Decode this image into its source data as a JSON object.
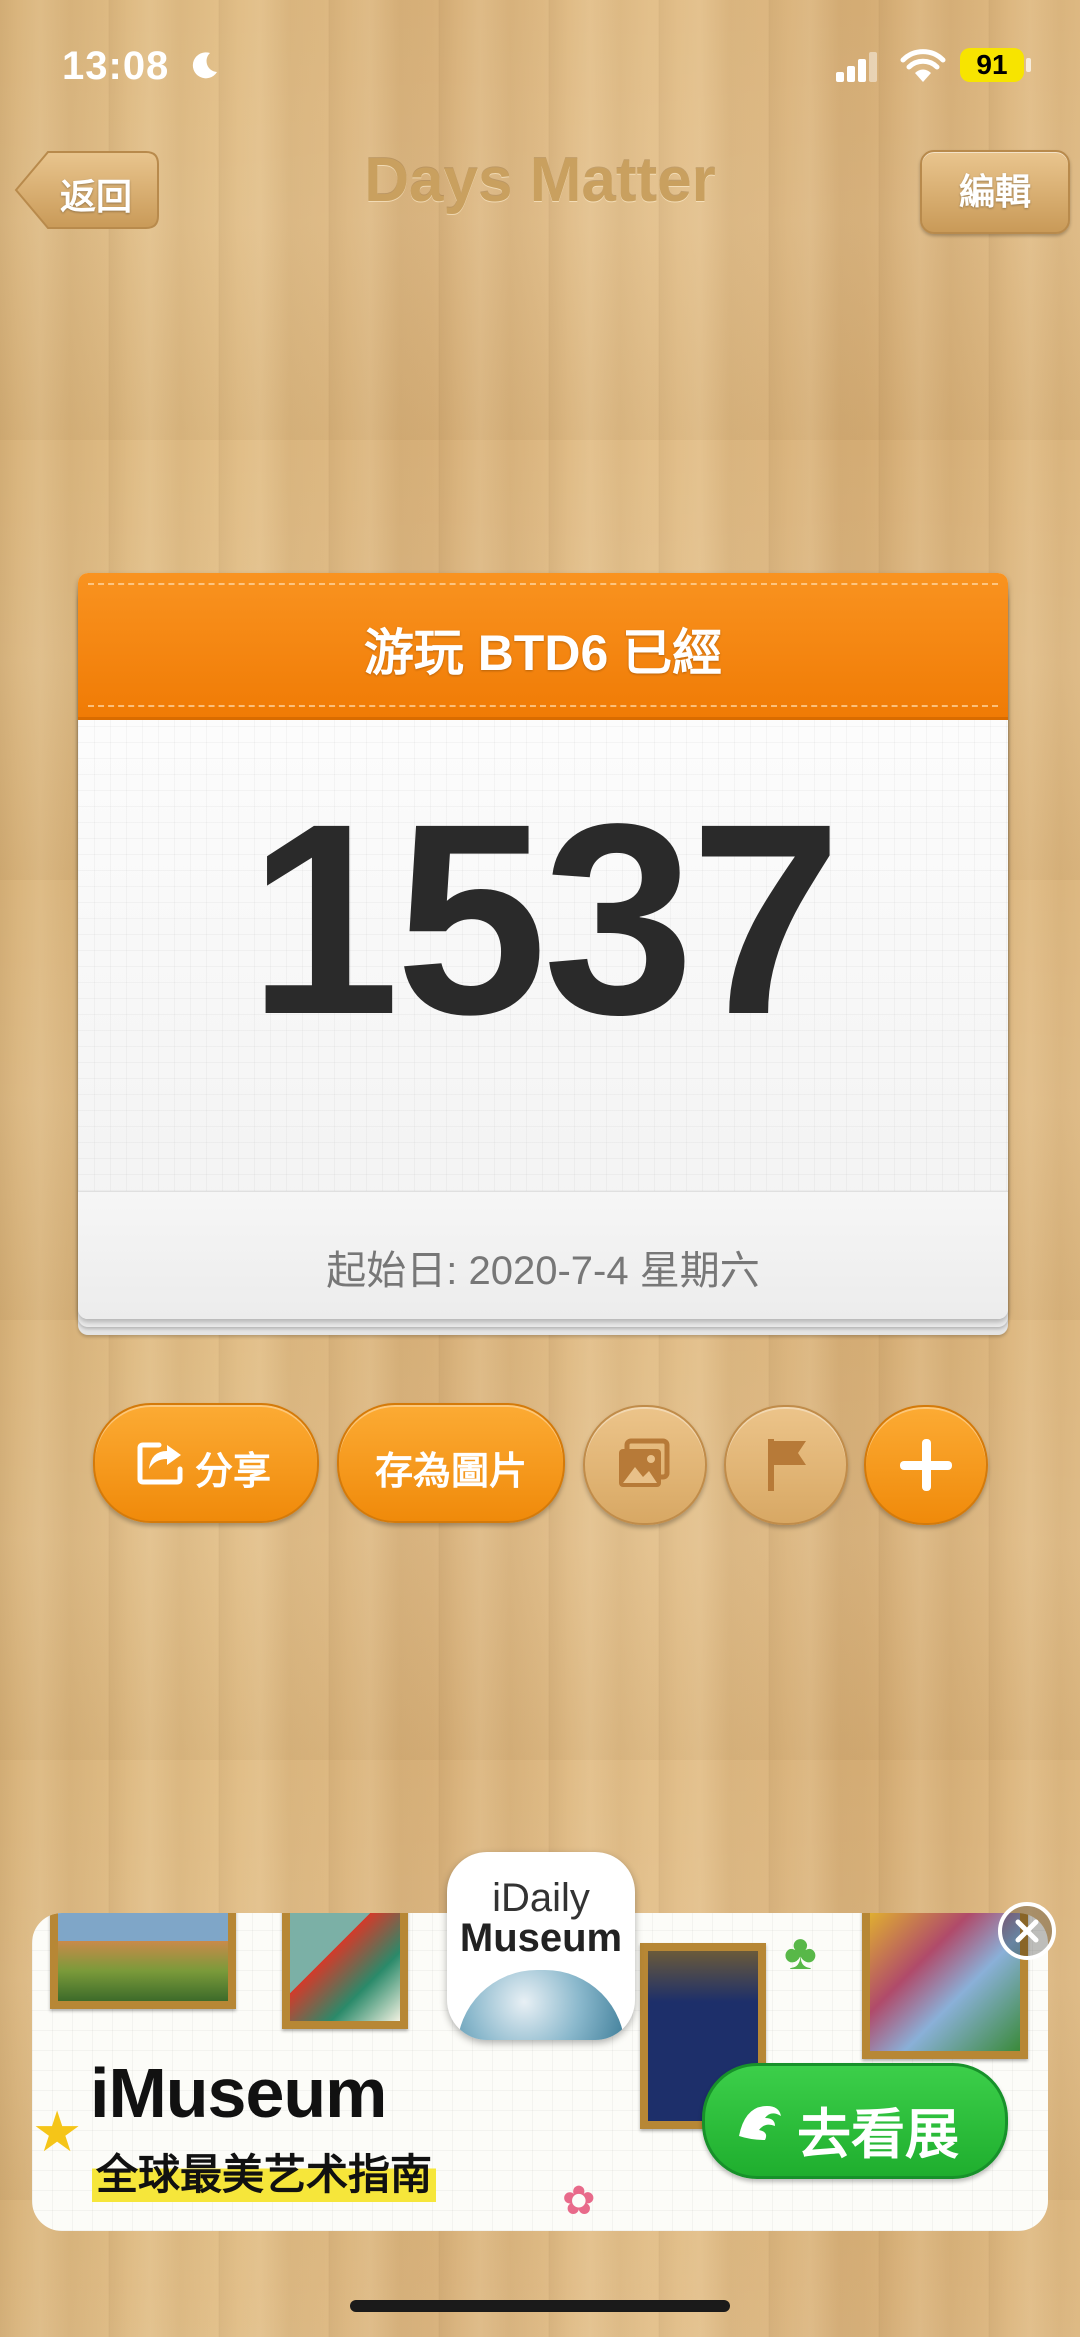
{
  "status_bar": {
    "time": "13:08",
    "battery": "91"
  },
  "nav": {
    "back_label": "返回",
    "title": "Days Matter",
    "edit_label": "編輯"
  },
  "card": {
    "title": "游玩 BTD6 已經",
    "count": "1537",
    "start_date": "起始日: 2020-7-4 星期六"
  },
  "actions": {
    "share_label": "分享",
    "save_image_label": "存為圖片"
  },
  "ad": {
    "app_name_line1": "iDaily",
    "app_name_line2": "Museum",
    "title": "iMuseum",
    "subtitle": "全球最美艺术指南",
    "cta_label": "去看展"
  },
  "colors": {
    "accent_orange": "#f08a0a",
    "ad_cta_green": "#1fae2e",
    "wood": "#ddb87f"
  },
  "icons": [
    "moon-icon",
    "signal-icon",
    "wifi-icon",
    "share-icon",
    "photo-icon",
    "flag-icon",
    "plus-icon",
    "close-icon",
    "wave-icon"
  ]
}
